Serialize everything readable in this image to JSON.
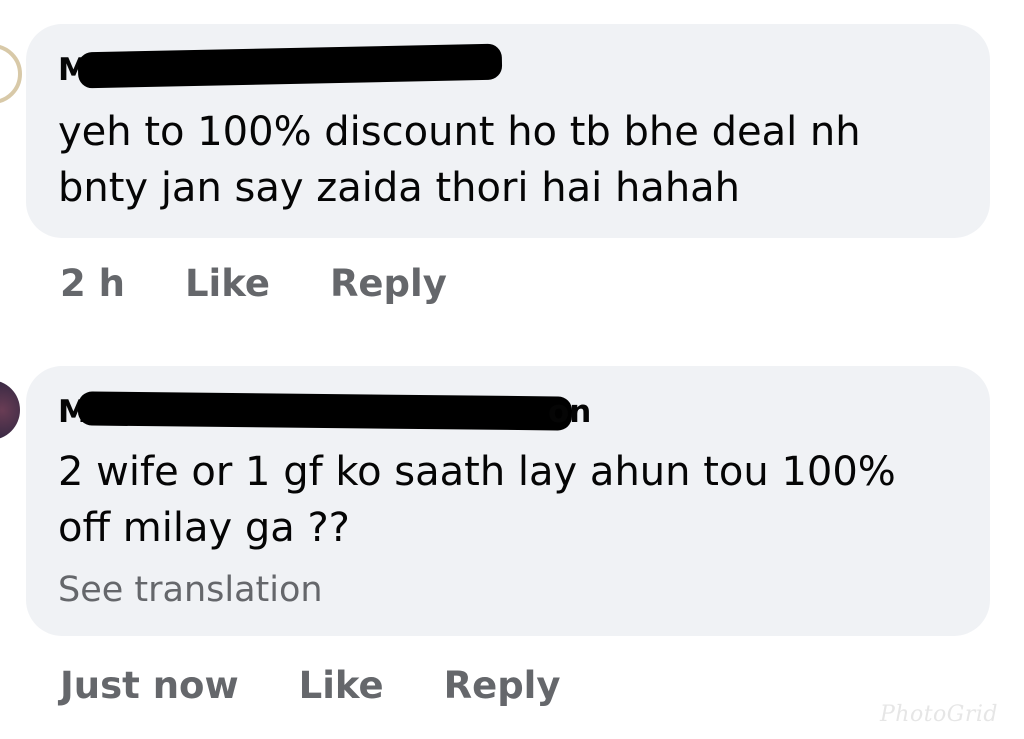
{
  "comments": [
    {
      "author_visible": "M",
      "text": "yeh to 100% discount ho tb bhe deal nh bnty jan say zaida thori hai hahah",
      "time": "2 h",
      "like_label": "Like",
      "reply_label": "Reply"
    },
    {
      "author_visible": "M",
      "author_tail": "on",
      "text": "2 wife or 1 gf ko saath lay ahun tou 100% off milay ga ??",
      "see_translation": "See translation",
      "time": "Just now",
      "like_label": "Like",
      "reply_label": "Reply"
    }
  ],
  "watermark": "PhotoGrid"
}
